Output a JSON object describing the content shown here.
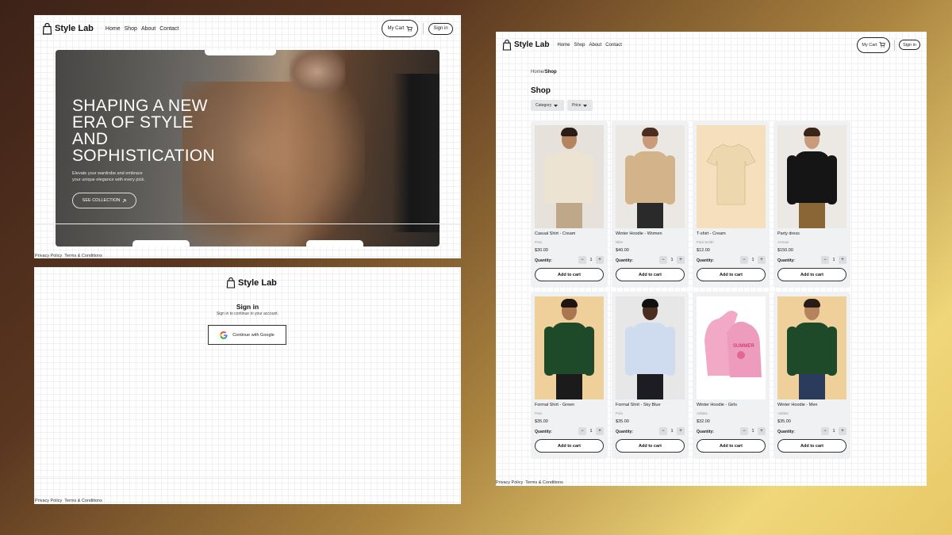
{
  "brand": {
    "name": "Style Lab"
  },
  "nav": {
    "links": [
      "Home",
      "Shop",
      "About",
      "Contact"
    ],
    "cart_label": "My Cart",
    "signin_label": "Sign in"
  },
  "hero": {
    "title_lines": [
      "SHAPING A NEW",
      "ERA OF STYLE",
      "AND",
      "SOPHISTICATION"
    ],
    "subtitle_lines": [
      "Elevate your wardrobe and embrace",
      "your unique elegance with every pick."
    ],
    "cta_label": "SEE COLLECTION",
    "cta_icon": "arrow-up-right-icon"
  },
  "footer": {
    "privacy": "Privacy Policy",
    "terms": "Terms & Conditions"
  },
  "signin_page": {
    "title": "Sign in",
    "subtitle": "Sign in to continue to your account.",
    "google_button": "Continue with Google"
  },
  "shop": {
    "breadcrumb": {
      "home": "Home",
      "separator": "/",
      "current": "Shop"
    },
    "title": "Shop",
    "filters": [
      {
        "label": "Category"
      },
      {
        "label": "Price"
      }
    ],
    "quantity_label": "Quantity:",
    "add_label": "Add to cart",
    "products": [
      {
        "name": "Casual Shirt - Cream",
        "brand": "Polo",
        "price": "$30.00",
        "qty": "1",
        "bg": "#e6e1da",
        "top": "#ece3d3",
        "bottom": "#bfa88a",
        "skin": "#b4845f",
        "hair": "#2a1d17"
      },
      {
        "name": "Winter Hoodie - Women",
        "brand": "Nike",
        "price": "$40.00",
        "qty": "1",
        "bg": "#ebe7e2",
        "top": "#d3b48a",
        "bottom": "#2a2a2a",
        "skin": "#c99b7a",
        "hair": "#4a2f20"
      },
      {
        "name": "T-shirt - Cream",
        "brand": "Paul Smith",
        "price": "$12.00",
        "qty": "1",
        "bg": "#f5dfbd",
        "top": "#edd7ae",
        "bottom": "",
        "skin": "",
        "hair": ""
      },
      {
        "name": "Party dress",
        "brand": "Armani",
        "price": "$150.00",
        "qty": "1",
        "bg": "#ece9e4",
        "top": "#151515",
        "bottom": "#8a6536",
        "skin": "#c99b7a",
        "hair": "#3b2418"
      },
      {
        "name": "Formal Shirt - Green",
        "brand": "Polo",
        "price": "$35.00",
        "qty": "1",
        "bg": "#efcf9a",
        "top": "#1f4a2a",
        "bottom": "#1b1b1b",
        "skin": "#a9764f",
        "hair": "#1e1410"
      },
      {
        "name": "Formal Shirt - Sky Blue",
        "brand": "Polo",
        "price": "$35.00",
        "qty": "1",
        "bg": "#e7e7e7",
        "top": "#cfdcef",
        "bottom": "#1c1c22",
        "skin": "#4a2e1f",
        "hair": "#111111"
      },
      {
        "name": "Winter Hoodie - Girls",
        "brand": "Adidas",
        "price": "$32.00",
        "qty": "1",
        "bg": "#ffffff",
        "top": "#f2a9c6",
        "bottom": "",
        "skin": "",
        "hair": ""
      },
      {
        "name": "Winter Hoodie - Men",
        "brand": "Adidas",
        "price": "$35.00",
        "qty": "1",
        "bg": "#efcf9a",
        "top": "#1f4a2a",
        "bottom": "#2a3b5c",
        "skin": "#b4845f",
        "hair": "#2a1d17"
      }
    ]
  },
  "colors": {
    "accent": "#111111",
    "card_bg": "#f0f1f3",
    "filter_bg": "#e5e6e8"
  }
}
